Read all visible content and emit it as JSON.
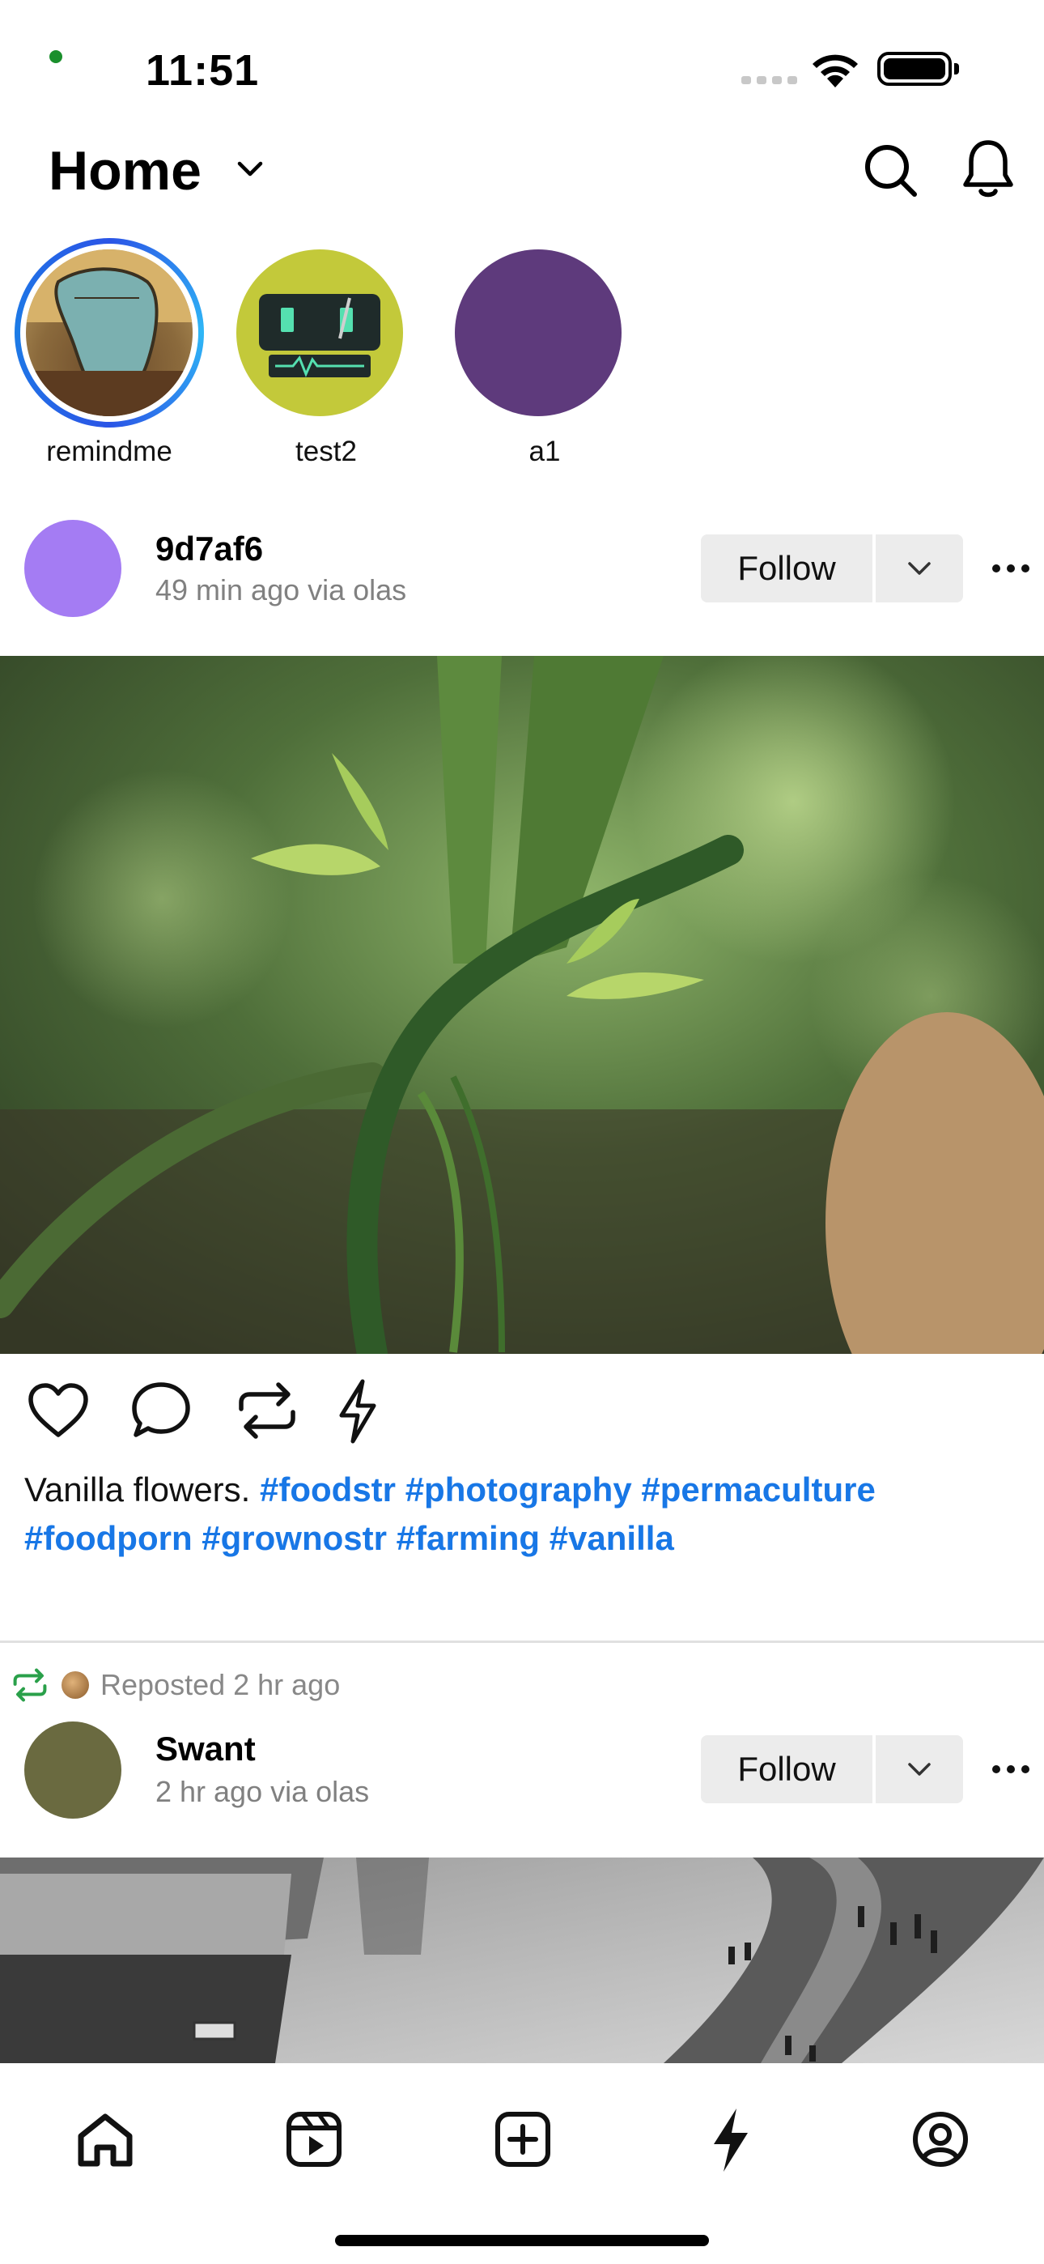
{
  "status_bar": {
    "time": "11:51"
  },
  "header": {
    "title": "Home"
  },
  "stories": [
    {
      "label": "remindme",
      "color": "#8b6a3c"
    },
    {
      "label": "test2",
      "color": "#c7cc3a"
    },
    {
      "label": "a1",
      "color": "#5e3a7c"
    }
  ],
  "post1": {
    "author": "9d7af6",
    "meta": "49 min ago via olas",
    "avatar_color": "#a47cf3",
    "follow_label": "Follow",
    "caption_text": "Vanilla flowers.",
    "hashtags": [
      "#foodstr",
      "#photography",
      "#permaculture",
      "#foodporn",
      "#grownostr",
      "#farming",
      "#vanilla"
    ]
  },
  "post2": {
    "repost_text": "Reposted 2 hr ago",
    "author": "Swant",
    "meta": "2 hr ago via olas",
    "avatar_color": "#6a6a40",
    "follow_label": "Follow"
  },
  "colors": {
    "accent": "#1877e6",
    "repost_green": "#2aa04a"
  }
}
